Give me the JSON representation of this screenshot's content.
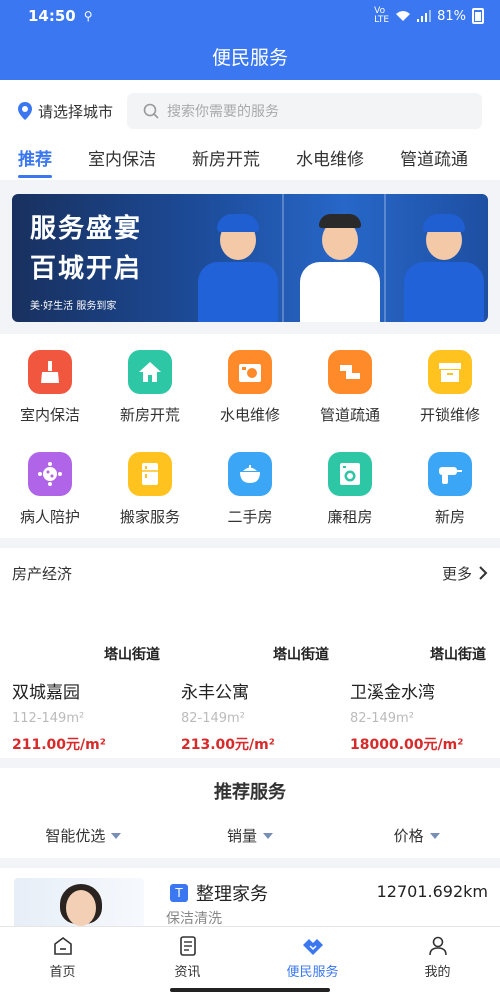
{
  "status": {
    "time": "14:50",
    "battery": "81%"
  },
  "title": "便民服务",
  "city_label": "请选择城市",
  "search_placeholder": "搜索你需要的服务",
  "tabs": [
    "推荐",
    "室内保洁",
    "新房开荒",
    "水电维修",
    "管道疏通"
  ],
  "banner": {
    "line1": "服务盛宴",
    "line2": "百城开启",
    "sub": "美·好生活  服务到家"
  },
  "services": [
    {
      "label": "室内保洁",
      "icon": "broom-icon",
      "color": "#f0573e"
    },
    {
      "label": "新房开荒",
      "icon": "house-icon",
      "color": "#2ec7a6"
    },
    {
      "label": "水电维修",
      "icon": "washer-icon",
      "color": "#ff8a2a"
    },
    {
      "label": "管道疏通",
      "icon": "pipe-icon",
      "color": "#ff8a2a"
    },
    {
      "label": "开锁维修",
      "icon": "box-icon",
      "color": "#ffc21f"
    },
    {
      "label": "病人陪护",
      "icon": "virus-icon",
      "color": "#b065e8"
    },
    {
      "label": "搬家服务",
      "icon": "fridge-icon",
      "color": "#ffc21f"
    },
    {
      "label": "二手房",
      "icon": "pot-icon",
      "color": "#3aa6f5"
    },
    {
      "label": "廉租房",
      "icon": "washing-machine-icon",
      "color": "#2ec7a6"
    },
    {
      "label": "新房",
      "icon": "drill-icon",
      "color": "#3aa6f5"
    }
  ],
  "estate": {
    "title": "房产经济",
    "more": "更多",
    "items": [
      {
        "street": "塔山街道",
        "name": "双城嘉园",
        "area": "112-149m²",
        "price": "211.00元/m²"
      },
      {
        "street": "塔山街道",
        "name": "永丰公寓",
        "area": "82-149m²",
        "price": "213.00元/m²"
      },
      {
        "street": "塔山街道",
        "name": "卫溪金水湾",
        "area": "82-149m²",
        "price": "18000.00元/m²"
      }
    ]
  },
  "recommend": {
    "title": "推荐服务",
    "filters": [
      "智能优选",
      "销量",
      "价格"
    ]
  },
  "card": {
    "tag": "T",
    "name": "整理家务",
    "distance": "12701.692km",
    "category": "保洁清洗"
  },
  "tabbar": [
    "首页",
    "资讯",
    "便民服务",
    "我的"
  ],
  "colors": {
    "primary": "#3a77f0",
    "price": "#d72a2a"
  }
}
